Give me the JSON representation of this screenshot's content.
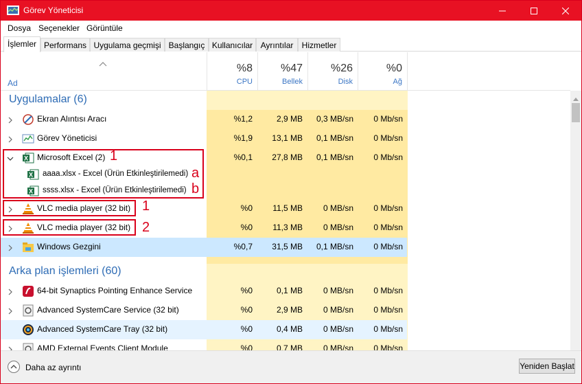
{
  "window": {
    "title": "Görev Yöneticisi"
  },
  "menu": [
    "Dosya",
    "Seçenekler",
    "Görüntüle"
  ],
  "tabs": [
    "İşlemler",
    "Performans",
    "Uygulama geçmişi",
    "Başlangıç",
    "Kullanıcılar",
    "Ayrıntılar",
    "Hizmetler"
  ],
  "header": {
    "name_label": "Ad",
    "cpu": {
      "pct": "%8",
      "label": "CPU"
    },
    "memory": {
      "pct": "%47",
      "label": "Bellek"
    },
    "disk": {
      "pct": "%26",
      "label": "Disk"
    },
    "network": {
      "pct": "%0",
      "label": "Ağ"
    }
  },
  "groups": {
    "apps": "Uygulamalar (6)",
    "background": "Arka plan işlemleri (60)"
  },
  "rows": [
    {
      "name": "Ekran Alıntısı Aracı",
      "cpu": "%1,2",
      "mem": "2,9 MB",
      "disk": "0,3 MB/sn",
      "net": "0 Mb/sn",
      "icon": "snipping-tool-icon"
    },
    {
      "name": "Görev Yöneticisi",
      "cpu": "%1,9",
      "mem": "13,1 MB",
      "disk": "0,1 MB/sn",
      "net": "0 Mb/sn",
      "icon": "task-manager-icon"
    },
    {
      "name": "Microsoft Excel (2)",
      "cpu": "%0,1",
      "mem": "27,8 MB",
      "disk": "0,1 MB/sn",
      "net": "0 Mb/sn",
      "icon": "excel-icon"
    },
    {
      "name": "aaaa.xlsx - Excel (Ürün Etkinleştirilemedi)",
      "icon": "excel-icon"
    },
    {
      "name": "ssss.xlsx - Excel (Ürün Etkinleştirilemedi)",
      "icon": "excel-icon"
    },
    {
      "name": "VLC media player (32 bit)",
      "cpu": "%0",
      "mem": "11,5 MB",
      "disk": "0 MB/sn",
      "net": "0 Mb/sn",
      "icon": "vlc-icon"
    },
    {
      "name": "VLC media player (32 bit)",
      "cpu": "%0",
      "mem": "11,3 MB",
      "disk": "0 MB/sn",
      "net": "0 Mb/sn",
      "icon": "vlc-icon"
    },
    {
      "name": "Windows Gezgini",
      "cpu": "%0,7",
      "mem": "31,5 MB",
      "disk": "0,1 MB/sn",
      "net": "0 Mb/sn",
      "icon": "explorer-icon"
    },
    {
      "name": "64-bit Synaptics Pointing Enhance Service",
      "cpu": "%0",
      "mem": "0,1 MB",
      "disk": "0 MB/sn",
      "net": "0 Mb/sn",
      "icon": "synaptics-icon"
    },
    {
      "name": "Advanced SystemCare Service (32 bit)",
      "cpu": "%0",
      "mem": "2,9 MB",
      "disk": "0 MB/sn",
      "net": "0 Mb/sn",
      "icon": "service-icon"
    },
    {
      "name": "Advanced SystemCare Tray (32 bit)",
      "cpu": "%0",
      "mem": "0,4 MB",
      "disk": "0 MB/sn",
      "net": "0 Mb/sn",
      "icon": "systemcare-icon"
    },
    {
      "name": "AMD External Events Client Module",
      "cpu": "%0",
      "mem": "0,7 MB",
      "disk": "0 MB/sn",
      "net": "0 Mb/sn",
      "icon": "service-icon"
    }
  ],
  "annotations": {
    "excel_group": "1",
    "child_a": "a",
    "child_b": "b",
    "vlc_1": "1",
    "vlc_2": "2"
  },
  "footer": {
    "fewer_details": "Daha az ayrıntı",
    "restart_button": "Yeniden Başlat"
  },
  "colors": {
    "titlebar": "#e81123",
    "heat_light": "#fff4c4",
    "heat_strong": "#ffeaa2",
    "selected": "#cce8ff",
    "annotation": "#d9001b",
    "group_text": "#2e6cb5"
  }
}
